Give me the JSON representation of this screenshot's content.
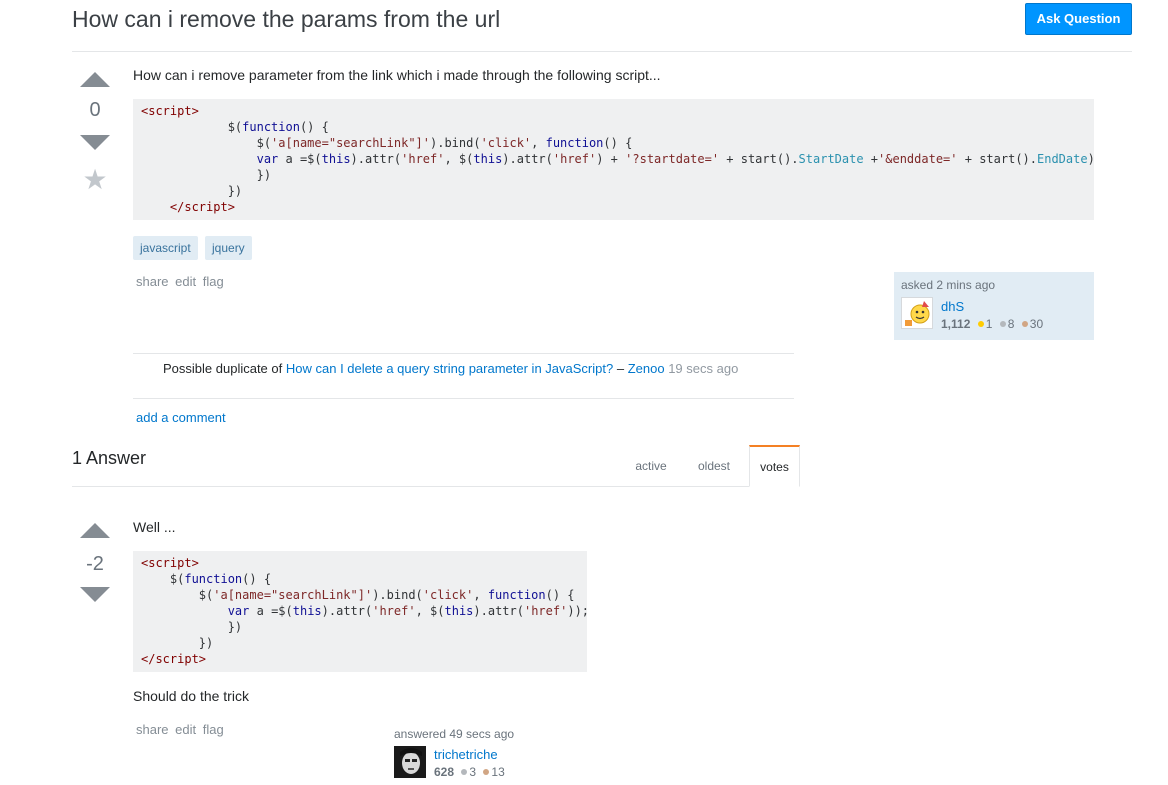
{
  "header": {
    "title": "How can i remove the params from the url",
    "ask_button": "Ask Question"
  },
  "question": {
    "vote_count": "0",
    "body_text": "How can i remove parameter from the link which i made through the following script...",
    "tags": [
      "javascript",
      "jquery"
    ],
    "menu": {
      "share": "share",
      "edit": "edit",
      "flag": "flag"
    },
    "signature": {
      "label": "asked 2 mins ago",
      "user": "dhS",
      "reputation": "1,112",
      "gold": "1",
      "silver": "8",
      "bronze": "30"
    },
    "comment": {
      "prefix": "Possible duplicate of",
      "link": "How can I delete a query string parameter in JavaScript?",
      "dash": "–",
      "author": "Zenoo",
      "time": "19 secs ago"
    },
    "add_comment": "add a comment"
  },
  "answers_header": {
    "count_label": "1 Answer",
    "tabs": [
      "active",
      "oldest",
      "votes"
    ],
    "selected_tab": "votes"
  },
  "answer": {
    "vote_count": "-2",
    "intro": "Well ...",
    "outro": "Should do the trick",
    "menu": {
      "share": "share",
      "edit": "edit",
      "flag": "flag"
    },
    "signature": {
      "label": "answered 49 secs ago",
      "user": "trichetriche",
      "reputation": "628",
      "silver": "3",
      "bronze": "13"
    }
  },
  "colors": {
    "accent": "#0095ff",
    "link": "#0077cc",
    "tag_bg": "#e1ecf4",
    "code_bg": "#eff0f1",
    "tab_highlight": "#f48024"
  }
}
